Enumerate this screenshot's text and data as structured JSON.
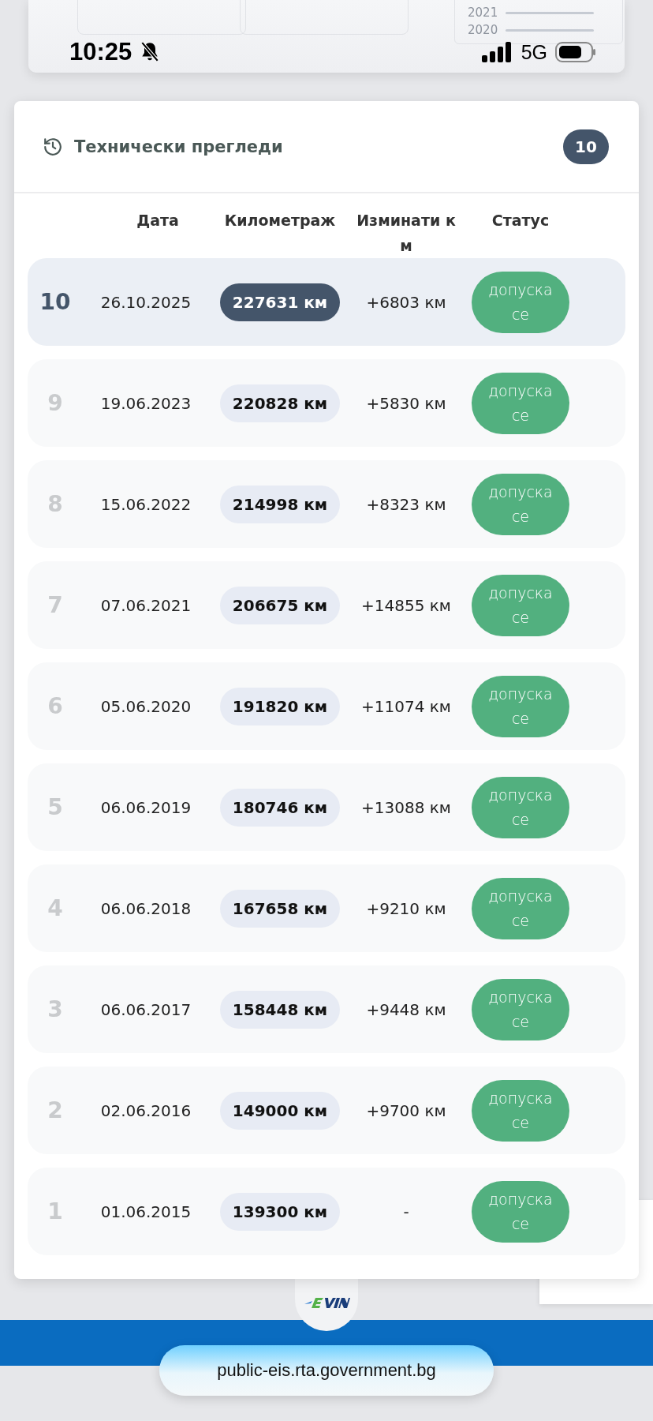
{
  "status_bar": {
    "time": "10:25",
    "silent": true,
    "network": "5G"
  },
  "background_legend": [
    "2021",
    "2020"
  ],
  "inspections": {
    "title": "Технически прегледи",
    "count": "10",
    "columns": [
      "Дата",
      "Километраж",
      "Изминати км"
    ],
    "status_column": "Статус",
    "rows": [
      {
        "number": "10",
        "date": "26.10.2025",
        "mileage": "227631 км",
        "change": "+6803 км",
        "status": "допуска се",
        "selected": true
      },
      {
        "number": "9",
        "date": "19.06.2023",
        "mileage": "220828 км",
        "change": "+5830 км",
        "status": "допуска се",
        "selected": false
      },
      {
        "number": "8",
        "date": "15.06.2022",
        "mileage": "214998 км",
        "change": "+8323 км",
        "status": "допуска се",
        "selected": false
      },
      {
        "number": "7",
        "date": "07.06.2021",
        "mileage": "206675 км",
        "change": "+14855 км",
        "status": "допуска се",
        "selected": false
      },
      {
        "number": "6",
        "date": "05.06.2020",
        "mileage": "191820 км",
        "change": "+11074 км",
        "status": "допуска се",
        "selected": false
      },
      {
        "number": "5",
        "date": "06.06.2019",
        "mileage": "180746 км",
        "change": "+13088 км",
        "status": "допуска се",
        "selected": false
      },
      {
        "number": "4",
        "date": "06.06.2018",
        "mileage": "167658 км",
        "change": "+9210 км",
        "status": "допуска се",
        "selected": false
      },
      {
        "number": "3",
        "date": "06.06.2017",
        "mileage": "158448 км",
        "change": "+9448 км",
        "status": "допуска се",
        "selected": false
      },
      {
        "number": "2",
        "date": "02.06.2016",
        "mileage": "149000 км",
        "change": "+9700 км",
        "status": "допуска се",
        "selected": false
      },
      {
        "number": "1",
        "date": "01.06.2015",
        "mileage": "139300 км",
        "change": "-",
        "status": "допуска се",
        "selected": false
      }
    ]
  },
  "address_bar": {
    "url": "public-eis.rta.government.bg"
  }
}
